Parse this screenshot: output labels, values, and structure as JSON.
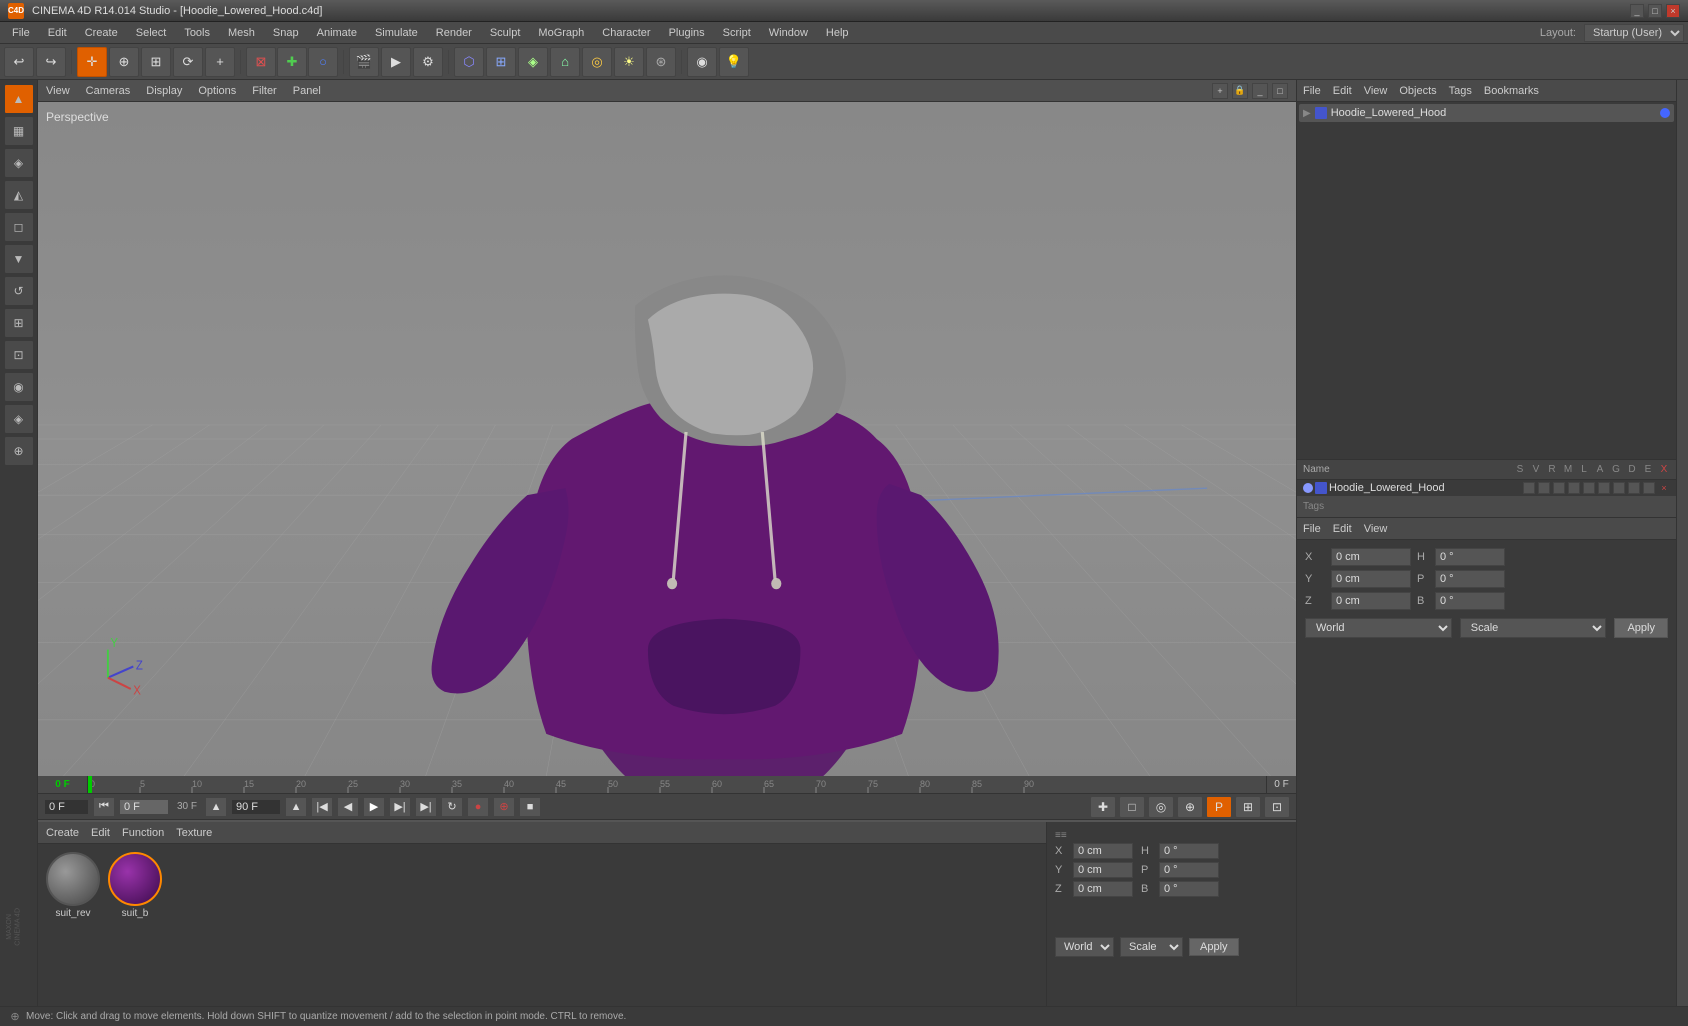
{
  "app": {
    "title": "CINEMA 4D R14.014 Studio - [Hoodie_Lowered_Hood.c4d]",
    "icon": "C4D"
  },
  "title_bar": {
    "title": "CINEMA 4D R14.014 Studio - [Hoodie_Lowered_Hood.c4d]",
    "minimize_label": "_",
    "maximize_label": "□",
    "close_label": "×"
  },
  "menu": {
    "items": [
      "File",
      "Edit",
      "Create",
      "Select",
      "Tools",
      "Mesh",
      "Snap",
      "Animate",
      "Simulate",
      "Render",
      "Sculpt",
      "MoGraph",
      "Character",
      "Plugins",
      "Script",
      "Window",
      "Help"
    ]
  },
  "layout": {
    "label": "Layout:",
    "value": "Startup (User)"
  },
  "toolbar": {
    "undo": "↩",
    "redo": "↪",
    "move": "⊕",
    "scale": "⊞",
    "rotate": "⟳",
    "add": "+",
    "tools": [
      "⊠",
      "✚",
      "○",
      "△",
      "□",
      "◎",
      "⬡",
      "⬤",
      "⌂",
      "⊛"
    ]
  },
  "viewport": {
    "menus": [
      "View",
      "Cameras",
      "Display",
      "Options",
      "Filter",
      "Panel"
    ],
    "perspective_label": "Perspective",
    "grid_color": "#888888",
    "bg_color": "#787878"
  },
  "right_panel": {
    "objects_header": [
      "File",
      "Edit",
      "View",
      "Objects",
      "Tags",
      "Bookmarks"
    ],
    "object_name": "Hoodie_Lowered_Hood",
    "object_color": "#4444ff",
    "col_headers": [
      "Name",
      "S",
      "V",
      "R",
      "M",
      "L",
      "A",
      "G",
      "D",
      "E",
      "X"
    ],
    "file_menu": [
      "File",
      "Edit",
      "View"
    ],
    "attr_label": "Name"
  },
  "attributes": {
    "x_label": "X",
    "y_label": "Y",
    "z_label": "Z",
    "x_val": "0 cm",
    "y_val": "0 cm",
    "z_val": "0 cm",
    "h_val": "0°",
    "p_val": "0°",
    "b_val": "0°",
    "x2_val": "0 cm",
    "y2_val": "0 cm",
    "z2_val": "0 cm",
    "coord_mode": "World",
    "transform_mode": "Scale",
    "apply_label": "Apply"
  },
  "timeline": {
    "frame_start": "0 F",
    "frame_current": "0 F",
    "fps": "30 F",
    "frame_end": "90 F",
    "marks": [
      "0",
      "5",
      "10",
      "15",
      "20",
      "25",
      "30",
      "35",
      "40",
      "45",
      "50",
      "55",
      "60",
      "65",
      "70",
      "75",
      "80",
      "85",
      "90"
    ]
  },
  "transport": {
    "frame_field": "0 F",
    "fps_field": "30 F",
    "end_field": "90 F",
    "play": "▶",
    "prev": "◀",
    "next": "▶",
    "first": "⏮",
    "last": "⏭",
    "record": "●",
    "stop": "■",
    "loop": "↻"
  },
  "materials": {
    "menu_items": [
      "Create",
      "Edit",
      "Function",
      "Texture"
    ],
    "items": [
      {
        "name": "suit_rev",
        "selected": false
      },
      {
        "name": "suit_b",
        "selected": true
      }
    ]
  },
  "status_bar": {
    "text": "Move: Click and drag to move elements. Hold down SHIFT to quantize movement / add to the selection in point mode. CTRL to remove."
  },
  "sidebar": {
    "buttons": [
      "▲",
      "▦",
      "◈",
      "◭",
      "◻",
      "▼",
      "↺",
      "⊞",
      "⊡",
      "◉",
      "◈",
      "⊕"
    ]
  }
}
